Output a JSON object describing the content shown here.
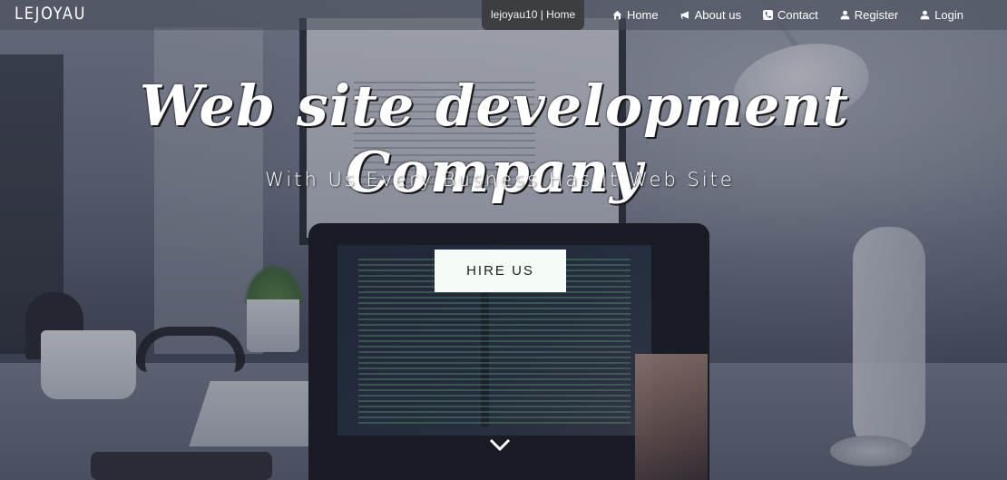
{
  "navbar": {
    "brand": "LEJOYAU",
    "tooltip": "lejoyau10 | Home",
    "links": [
      {
        "label": "Home",
        "icon": "home-icon"
      },
      {
        "label": "About us",
        "icon": "bullhorn-icon"
      },
      {
        "label": "Contact",
        "icon": "phone-icon"
      },
      {
        "label": "Register",
        "icon": "user-icon"
      },
      {
        "label": "Login",
        "icon": "user-icon"
      }
    ]
  },
  "hero": {
    "title": "Web site development Company",
    "subtitle": "With Us Every Busness Has It Web Site",
    "cta_label": "HIRE US",
    "scroll_icon": "chevron-down-icon"
  },
  "colors": {
    "navbar_bg": "#464a58",
    "tooltip_bg": "#3d3e42",
    "cta_bg": "#f5fbf6",
    "text": "#ffffff"
  }
}
